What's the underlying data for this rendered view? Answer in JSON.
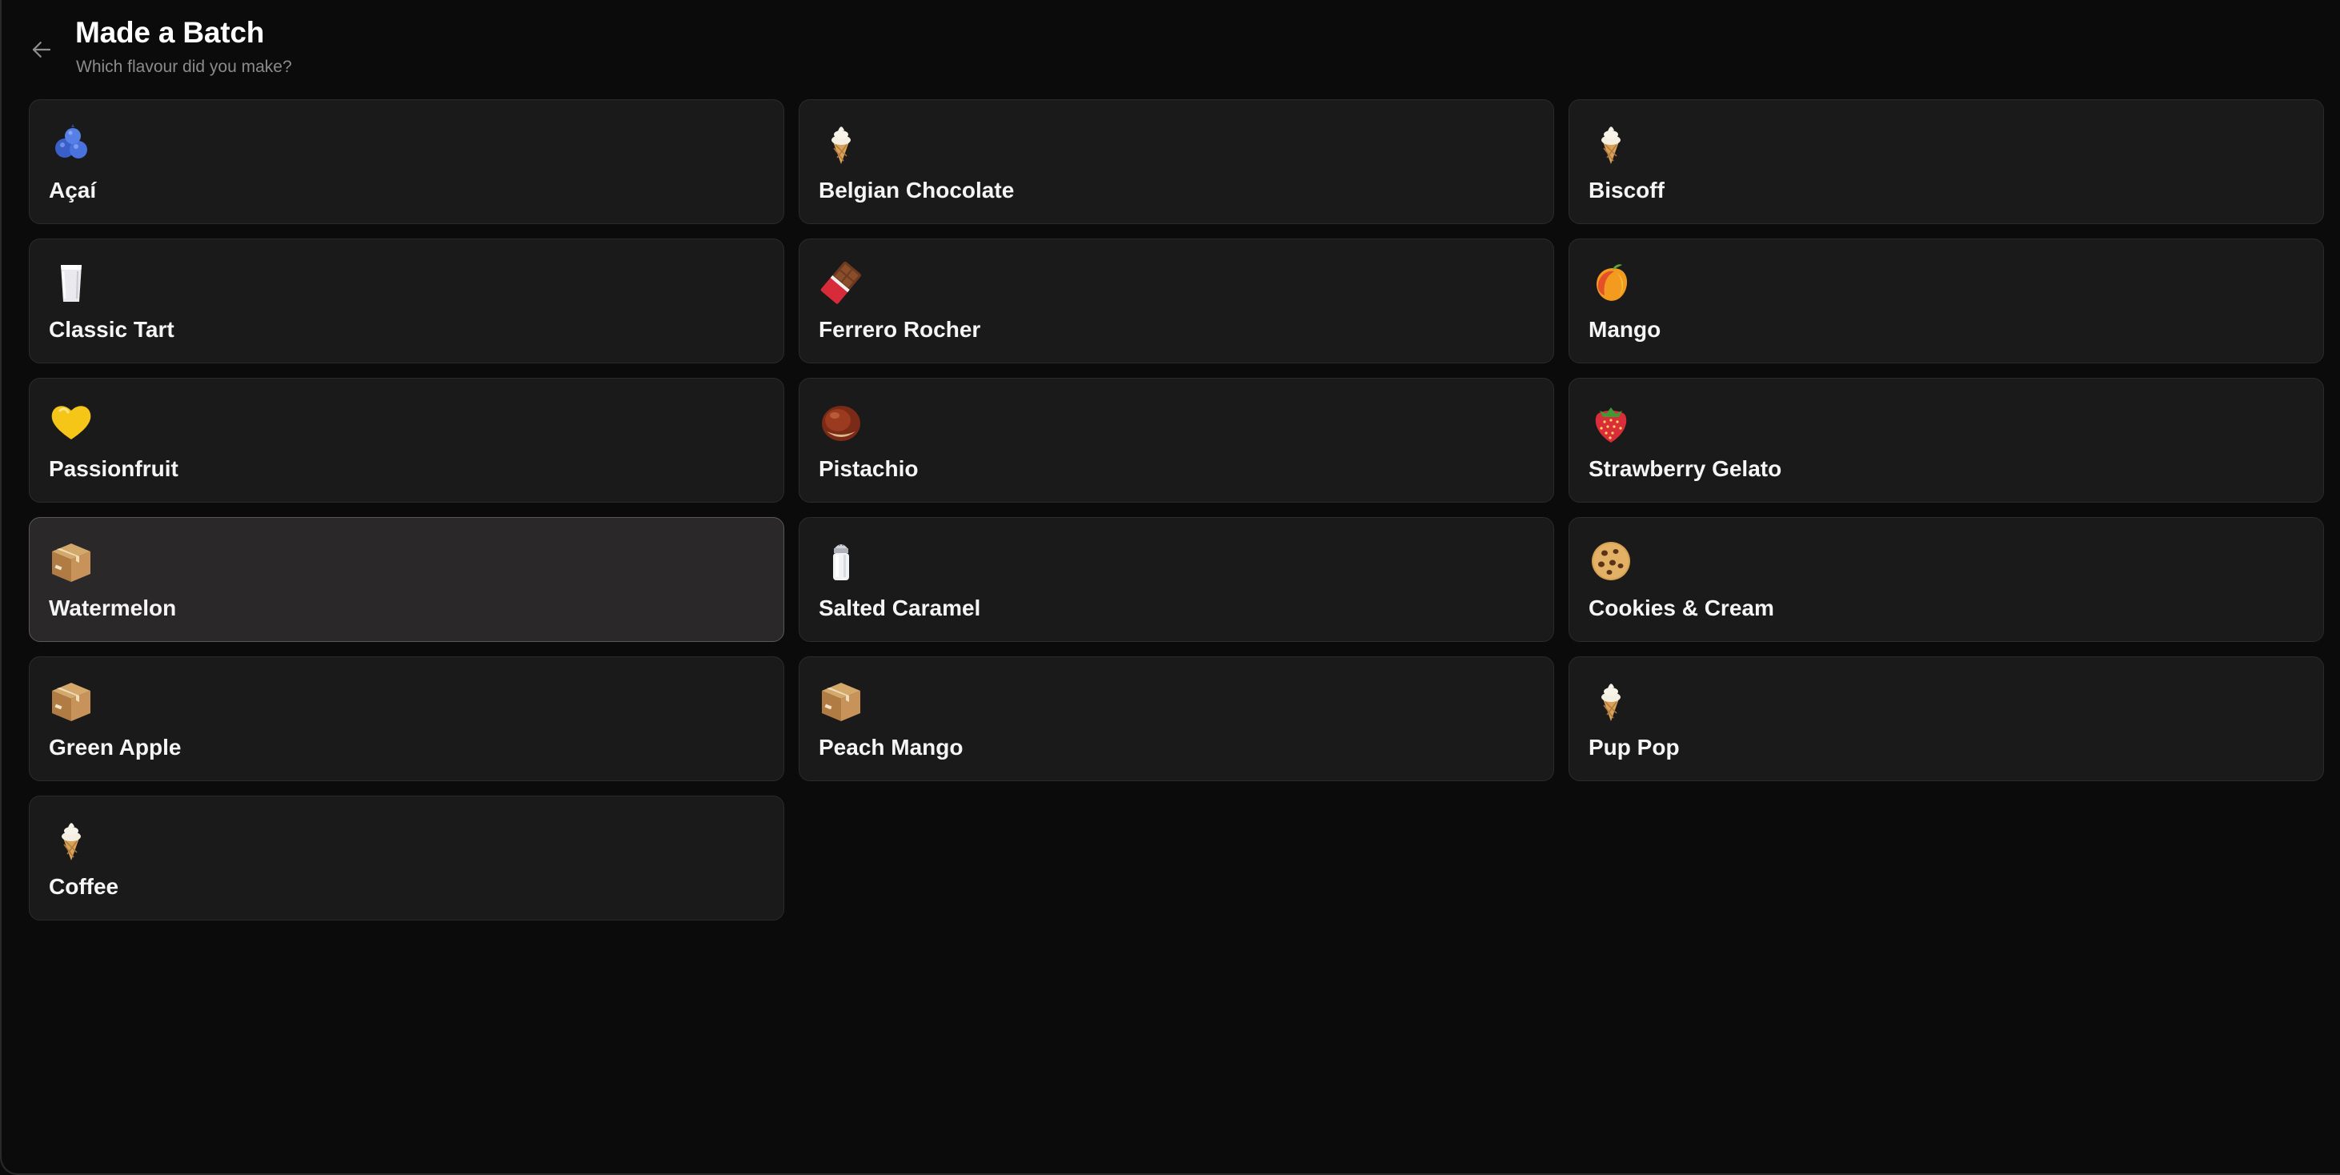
{
  "header": {
    "title": "Made a Batch",
    "subtitle": "Which flavour did you make?",
    "back_icon": "arrow-left-icon"
  },
  "flavours": [
    {
      "label": "Açaí",
      "icon": "blueberries-icon",
      "selected": false
    },
    {
      "label": "Belgian Chocolate",
      "icon": "ice-cream-cone-icon",
      "selected": false
    },
    {
      "label": "Biscoff",
      "icon": "ice-cream-cone-icon",
      "selected": false
    },
    {
      "label": "Classic Tart",
      "icon": "milk-glass-icon",
      "selected": false
    },
    {
      "label": "Ferrero Rocher",
      "icon": "chocolate-bar-icon",
      "selected": false
    },
    {
      "label": "Mango",
      "icon": "mango-icon",
      "selected": false
    },
    {
      "label": "Passionfruit",
      "icon": "yellow-heart-icon",
      "selected": false
    },
    {
      "label": "Pistachio",
      "icon": "chestnut-icon",
      "selected": false
    },
    {
      "label": "Strawberry Gelato",
      "icon": "strawberry-icon",
      "selected": false
    },
    {
      "label": "Watermelon",
      "icon": "package-box-icon",
      "selected": true
    },
    {
      "label": "Salted Caramel",
      "icon": "salt-shaker-icon",
      "selected": false
    },
    {
      "label": "Cookies & Cream",
      "icon": "cookie-icon",
      "selected": false
    },
    {
      "label": "Green Apple",
      "icon": "package-box-icon",
      "selected": false
    },
    {
      "label": "Peach Mango",
      "icon": "package-box-icon",
      "selected": false
    },
    {
      "label": "Pup Pop",
      "icon": "ice-cream-cone-icon",
      "selected": false
    },
    {
      "label": "Coffee",
      "icon": "ice-cream-cone-icon",
      "selected": false
    }
  ],
  "colors": {
    "background": "#0b0b0b",
    "card": "#1a1a1a",
    "card_border": "#2b2b2b",
    "card_selected": "#2a2828",
    "card_selected_border": "#5a5858",
    "subtitle": "#8b8b8b"
  }
}
